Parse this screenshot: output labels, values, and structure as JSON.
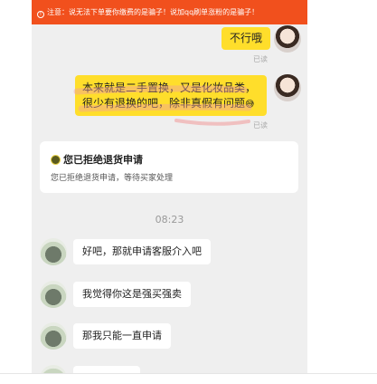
{
  "warning": {
    "icon": "info-circle-icon",
    "text": "注意：说无法下单要你缴费的是骗子！说加qq刷单涨粉的是骗子！"
  },
  "messages_sent": [
    {
      "text": "不行哦",
      "status": "已读"
    },
    {
      "line1": "本来就是二手置换，又是化妆品类，",
      "line2": "很少有退换的吧，除非真假有问题",
      "emoji": "😅",
      "status": "已读"
    }
  ],
  "refund_card": {
    "icon": "coin-icon",
    "title": "您已拒绝退货申请",
    "description": "您已拒绝退货申请，等待买家处理"
  },
  "time_label": "08:23",
  "messages_received": [
    {
      "text": "好吧，那就申请客服介入吧"
    },
    {
      "text": "我觉得你这是强买强卖"
    },
    {
      "text": "那我只能一直申请"
    }
  ],
  "colors": {
    "warning_bg": "#f1501d",
    "sent_bubble": "#ffde2b",
    "chat_bg": "#efefef",
    "highlight": "#f0a0a0"
  }
}
